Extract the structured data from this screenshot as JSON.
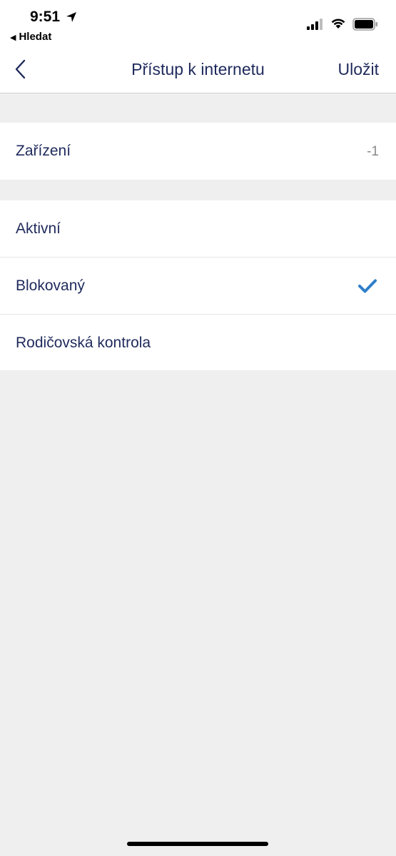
{
  "status_bar": {
    "time": "9:51",
    "back_app_label": "Hledat"
  },
  "nav": {
    "title": "Přístup k internetu",
    "save_label": "Uložit"
  },
  "device_row": {
    "label": "Zařízení",
    "value": "-1"
  },
  "options": [
    {
      "label": "Aktivní",
      "selected": false
    },
    {
      "label": "Blokovaný",
      "selected": true
    },
    {
      "label": "Rodičovská kontrola",
      "selected": false
    }
  ],
  "colors": {
    "text": "#1f2a5c",
    "accent_check": "#2f7fcb",
    "background": "#efefef"
  }
}
